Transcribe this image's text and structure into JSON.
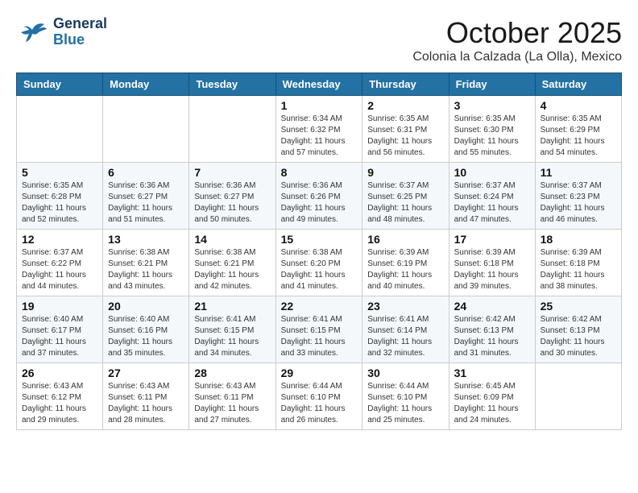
{
  "header": {
    "logo": {
      "general": "General",
      "blue": "Blue"
    },
    "title": "October 2025",
    "subtitle": "Colonia la Calzada (La Olla), Mexico"
  },
  "calendar": {
    "days_of_week": [
      "Sunday",
      "Monday",
      "Tuesday",
      "Wednesday",
      "Thursday",
      "Friday",
      "Saturday"
    ],
    "weeks": [
      [
        {
          "day": "",
          "info": ""
        },
        {
          "day": "",
          "info": ""
        },
        {
          "day": "",
          "info": ""
        },
        {
          "day": "1",
          "info": "Sunrise: 6:34 AM\nSunset: 6:32 PM\nDaylight: 11 hours and 57 minutes."
        },
        {
          "day": "2",
          "info": "Sunrise: 6:35 AM\nSunset: 6:31 PM\nDaylight: 11 hours and 56 minutes."
        },
        {
          "day": "3",
          "info": "Sunrise: 6:35 AM\nSunset: 6:30 PM\nDaylight: 11 hours and 55 minutes."
        },
        {
          "day": "4",
          "info": "Sunrise: 6:35 AM\nSunset: 6:29 PM\nDaylight: 11 hours and 54 minutes."
        }
      ],
      [
        {
          "day": "5",
          "info": "Sunrise: 6:35 AM\nSunset: 6:28 PM\nDaylight: 11 hours and 52 minutes."
        },
        {
          "day": "6",
          "info": "Sunrise: 6:36 AM\nSunset: 6:27 PM\nDaylight: 11 hours and 51 minutes."
        },
        {
          "day": "7",
          "info": "Sunrise: 6:36 AM\nSunset: 6:27 PM\nDaylight: 11 hours and 50 minutes."
        },
        {
          "day": "8",
          "info": "Sunrise: 6:36 AM\nSunset: 6:26 PM\nDaylight: 11 hours and 49 minutes."
        },
        {
          "day": "9",
          "info": "Sunrise: 6:37 AM\nSunset: 6:25 PM\nDaylight: 11 hours and 48 minutes."
        },
        {
          "day": "10",
          "info": "Sunrise: 6:37 AM\nSunset: 6:24 PM\nDaylight: 11 hours and 47 minutes."
        },
        {
          "day": "11",
          "info": "Sunrise: 6:37 AM\nSunset: 6:23 PM\nDaylight: 11 hours and 46 minutes."
        }
      ],
      [
        {
          "day": "12",
          "info": "Sunrise: 6:37 AM\nSunset: 6:22 PM\nDaylight: 11 hours and 44 minutes."
        },
        {
          "day": "13",
          "info": "Sunrise: 6:38 AM\nSunset: 6:21 PM\nDaylight: 11 hours and 43 minutes."
        },
        {
          "day": "14",
          "info": "Sunrise: 6:38 AM\nSunset: 6:21 PM\nDaylight: 11 hours and 42 minutes."
        },
        {
          "day": "15",
          "info": "Sunrise: 6:38 AM\nSunset: 6:20 PM\nDaylight: 11 hours and 41 minutes."
        },
        {
          "day": "16",
          "info": "Sunrise: 6:39 AM\nSunset: 6:19 PM\nDaylight: 11 hours and 40 minutes."
        },
        {
          "day": "17",
          "info": "Sunrise: 6:39 AM\nSunset: 6:18 PM\nDaylight: 11 hours and 39 minutes."
        },
        {
          "day": "18",
          "info": "Sunrise: 6:39 AM\nSunset: 6:18 PM\nDaylight: 11 hours and 38 minutes."
        }
      ],
      [
        {
          "day": "19",
          "info": "Sunrise: 6:40 AM\nSunset: 6:17 PM\nDaylight: 11 hours and 37 minutes."
        },
        {
          "day": "20",
          "info": "Sunrise: 6:40 AM\nSunset: 6:16 PM\nDaylight: 11 hours and 35 minutes."
        },
        {
          "day": "21",
          "info": "Sunrise: 6:41 AM\nSunset: 6:15 PM\nDaylight: 11 hours and 34 minutes."
        },
        {
          "day": "22",
          "info": "Sunrise: 6:41 AM\nSunset: 6:15 PM\nDaylight: 11 hours and 33 minutes."
        },
        {
          "day": "23",
          "info": "Sunrise: 6:41 AM\nSunset: 6:14 PM\nDaylight: 11 hours and 32 minutes."
        },
        {
          "day": "24",
          "info": "Sunrise: 6:42 AM\nSunset: 6:13 PM\nDaylight: 11 hours and 31 minutes."
        },
        {
          "day": "25",
          "info": "Sunrise: 6:42 AM\nSunset: 6:13 PM\nDaylight: 11 hours and 30 minutes."
        }
      ],
      [
        {
          "day": "26",
          "info": "Sunrise: 6:43 AM\nSunset: 6:12 PM\nDaylight: 11 hours and 29 minutes."
        },
        {
          "day": "27",
          "info": "Sunrise: 6:43 AM\nSunset: 6:11 PM\nDaylight: 11 hours and 28 minutes."
        },
        {
          "day": "28",
          "info": "Sunrise: 6:43 AM\nSunset: 6:11 PM\nDaylight: 11 hours and 27 minutes."
        },
        {
          "day": "29",
          "info": "Sunrise: 6:44 AM\nSunset: 6:10 PM\nDaylight: 11 hours and 26 minutes."
        },
        {
          "day": "30",
          "info": "Sunrise: 6:44 AM\nSunset: 6:10 PM\nDaylight: 11 hours and 25 minutes."
        },
        {
          "day": "31",
          "info": "Sunrise: 6:45 AM\nSunset: 6:09 PM\nDaylight: 11 hours and 24 minutes."
        },
        {
          "day": "",
          "info": ""
        }
      ]
    ]
  }
}
